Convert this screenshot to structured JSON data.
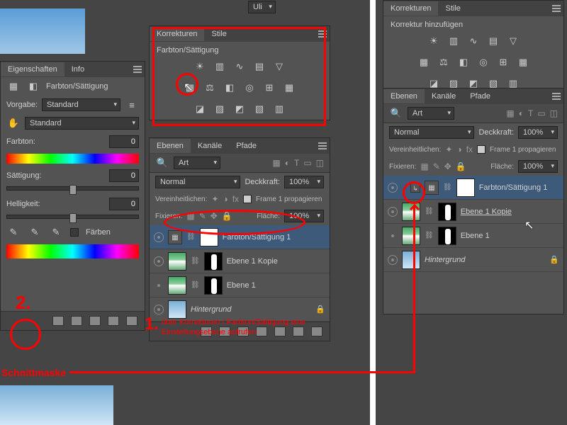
{
  "profile_dropdown": "Uli",
  "left": {
    "tabs": [
      "Eigenschaften",
      "Info"
    ],
    "adj_title": "Farbton/Sättigung",
    "preset_label": "Vorgabe:",
    "preset_value": "Standard",
    "channel_value": "Standard",
    "hue_label": "Farbton:",
    "hue_value": "0",
    "sat_label": "Sättigung:",
    "sat_value": "0",
    "light_label": "Helligkeit:",
    "light_value": "0",
    "colorize_label": "Färben"
  },
  "mid": {
    "korr_tabs": [
      "Korrekturen",
      "Stile"
    ],
    "korr_title": "Farbton/Sättigung",
    "layers_tabs": [
      "Ebenen",
      "Kanäle",
      "Pfade"
    ],
    "filter_label": "Art",
    "blend_mode": "Normal",
    "opacity_label": "Deckkraft:",
    "opacity_value": "100%",
    "unify_label": "Vereinheitlichen:",
    "propagate_label": "Frame 1 propagieren",
    "lock_label": "Fixieren:",
    "fill_label": "Fläche:",
    "fill_value": "100%",
    "layers": [
      {
        "name": "Farbton/Sättigung 1",
        "type": "adj",
        "selected": true
      },
      {
        "name": "Ebene 1 Kopie",
        "type": "masked"
      },
      {
        "name": "Ebene 1",
        "type": "masked"
      },
      {
        "name": "Hintergrund",
        "type": "bg"
      }
    ]
  },
  "right": {
    "korr_tabs": [
      "Korrekturen",
      "Stile"
    ],
    "add_label": "Korrektur hinzufügen",
    "layers_tabs": [
      "Ebenen",
      "Kanäle",
      "Pfade"
    ],
    "filter_label": "Art",
    "blend_mode": "Normal",
    "opacity_label": "Deckkraft:",
    "opacity_value": "100%",
    "unify_label": "Vereinheitlichen:",
    "propagate_label": "Frame 1 propagieren",
    "lock_label": "Fixieren:",
    "fill_label": "Fläche:",
    "fill_value": "100%",
    "layers": [
      {
        "name": "Farbton/Sättigung 1",
        "type": "adj-clip",
        "selected": true
      },
      {
        "name": "Ebene 1 Kopie",
        "type": "masked"
      },
      {
        "name": "Ebene 1",
        "type": "masked"
      },
      {
        "name": "Hintergrund",
        "type": "bg"
      }
    ]
  },
  "annotations": {
    "num1": "1.",
    "text1": "über Korrekturen / Farbton/Sättigung eine Einstellungsebene aufrufen",
    "num2": "2.",
    "schnittmaske": "Schnittmaske"
  }
}
